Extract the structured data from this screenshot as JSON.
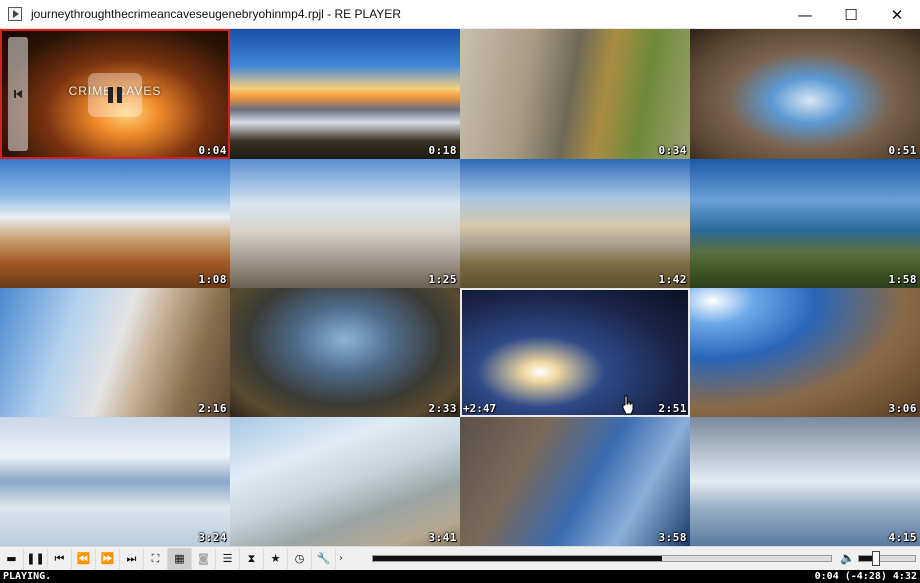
{
  "window": {
    "title": "journeythroughthecrimeancaveseugenebryohinmp4.rpjl - RE PLAYER",
    "minimize_glyph": "—",
    "maximize_glyph": "☐",
    "close_glyph": "✕"
  },
  "player": {
    "overlay_title": "CRIME   CAVES"
  },
  "tiles": [
    {
      "time": "0:04"
    },
    {
      "time": "0:18"
    },
    {
      "time": "0:34"
    },
    {
      "time": "0:51"
    },
    {
      "time": "1:08"
    },
    {
      "time": "1:25"
    },
    {
      "time": "1:42"
    },
    {
      "time": "1:58"
    },
    {
      "time": "2:16"
    },
    {
      "time": "2:33"
    },
    {
      "time": "2:51",
      "elapsed": "+2:47"
    },
    {
      "time": "3:06"
    },
    {
      "time": "3:24"
    },
    {
      "time": "3:41"
    },
    {
      "time": "3:58"
    },
    {
      "time": "4:15"
    }
  ],
  "toolbar": {
    "open": "▬",
    "pause": "❚❚",
    "prev": "⏮",
    "rewind": "⏪",
    "forward": "⏩",
    "next": "⏭",
    "fullscreen": "⛶",
    "grid": "▦",
    "snapshot": "◙",
    "playlist": "☰",
    "hourglass": "⧗",
    "favorite": "★",
    "clock": "◷",
    "settings": "🔧",
    "more": "›",
    "volume_icon": "🔈",
    "seek_progress": 0.63,
    "volume_level": 0.3
  },
  "status": {
    "state": "PLAYING.",
    "time": "0:04 (-4:28) 4:32"
  },
  "colors": {
    "active_border": "#d82020",
    "hover_border": "#e8e8e8"
  }
}
